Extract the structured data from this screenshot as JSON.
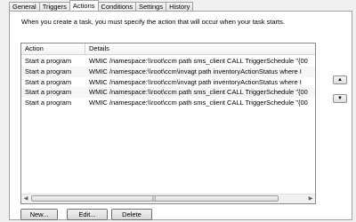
{
  "tabs": [
    {
      "label": "General",
      "active": false
    },
    {
      "label": "Triggers",
      "active": false
    },
    {
      "label": "Actions",
      "active": true
    },
    {
      "label": "Conditions",
      "active": false
    },
    {
      "label": "Settings",
      "active": false
    },
    {
      "label": "History",
      "active": false
    }
  ],
  "description": "When you create a task, you must specify the action that will occur when your task starts.",
  "table": {
    "columns": [
      "Action",
      "Details"
    ],
    "rows": [
      {
        "action": "Start a program",
        "details": "WMIC /namespace:\\\\root\\ccm path sms_client CALL TriggerSchedule \"{00"
      },
      {
        "action": "Start a program",
        "details": "WMIC /namespace:\\\\root\\ccm\\invagt path inventoryActionStatus where I"
      },
      {
        "action": "Start a program",
        "details": "WMIC /namespace:\\\\root\\ccm\\invagt path inventoryActionStatus where I"
      },
      {
        "action": "Start a program",
        "details": "WMIC /namespace:\\\\root\\ccm path sms_client CALL TriggerSchedule \"{00"
      },
      {
        "action": "Start a program",
        "details": "WMIC /namespace:\\\\root\\ccm path sms_client CALL TriggerSchedule \"{00"
      }
    ]
  },
  "buttons": {
    "new": "New...",
    "edit": "Edit...",
    "delete": "Delete"
  },
  "icons": {
    "move_up": "triangle-up-icon",
    "move_down": "triangle-down-icon"
  }
}
